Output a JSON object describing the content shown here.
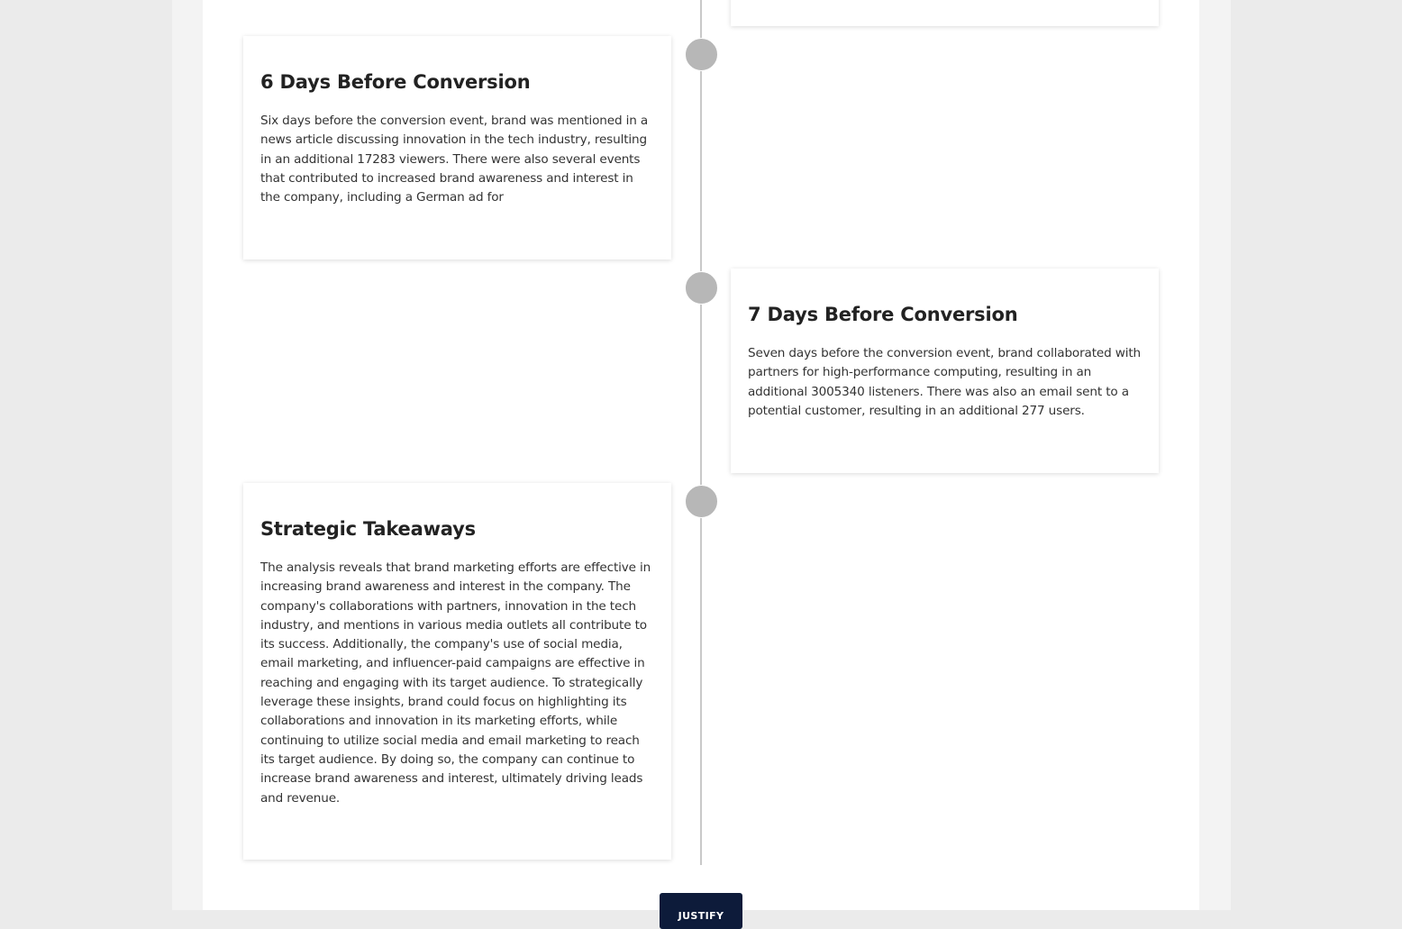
{
  "timeline": {
    "items": [
      {
        "title": "6 Days Before Conversion",
        "body": "Six days before the conversion event,  brand was mentioned in a news article discussing innovation in the tech industry, resulting in an additional 17283 viewers. There were also several events that contributed to increased brand awareness and interest in the company, including a German ad for"
      },
      {
        "title": "7 Days Before Conversion",
        "body": "Seven days before the conversion event, brand collaborated with partners for high-performance computing, resulting in an additional 3005340 listeners. There was also an email sent to a potential customer, resulting in an additional 277 users."
      },
      {
        "title": "Strategic Takeaways",
        "body": "The analysis reveals that  brand  marketing efforts are effective in increasing brand awareness and interest in the company. The company's collaborations with partners, innovation in the tech industry, and mentions in various media outlets all contribute to its success. Additionally, the company's use of social media, email marketing, and influencer-paid campaigns are effective in reaching and engaging with its target audience. To strategically leverage these insights, brand could focus on highlighting its collaborations and innovation in its marketing efforts, while continuing to utilize social media and email marketing to reach its target audience. By doing so, the company can continue to increase brand awareness and interest, ultimately driving leads and revenue."
      }
    ]
  },
  "actions": {
    "justify_label": "JUSTIFY"
  }
}
